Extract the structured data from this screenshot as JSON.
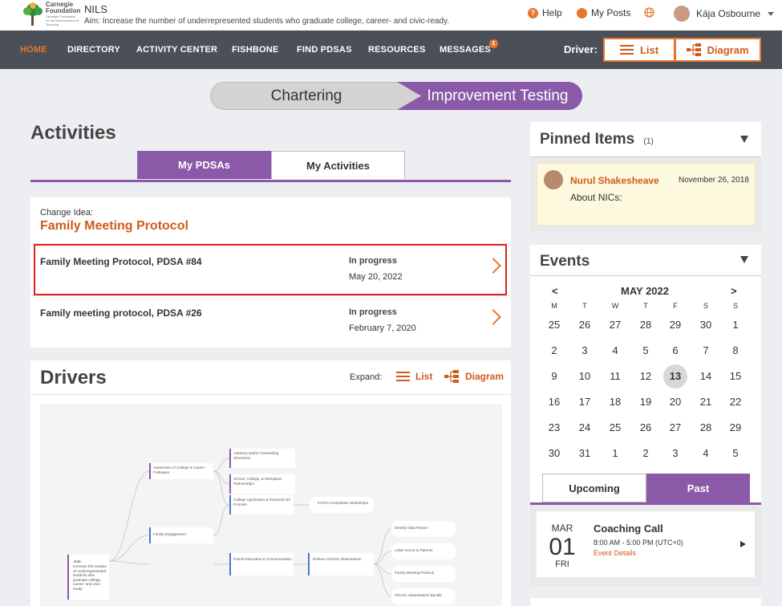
{
  "header": {
    "logo_text": "Carnegie Foundation for the Advancement of Teaching",
    "logo_line1": "Carnegie",
    "logo_line2": "Foundation",
    "site_name": "NILS",
    "aim": "Aim:  Increase the number of underrepresented students who graduate college, career- and civic-ready.",
    "help": "Help",
    "my_posts": "My Posts",
    "user_name": "Kája Osbourne"
  },
  "nav": {
    "items": [
      "HOME",
      "DIRECTORY",
      "ACTIVITY CENTER",
      "FISHBONE",
      "FIND PDSAS",
      "RESOURCES",
      "MESSAGES"
    ],
    "messages_badge": "1",
    "driver_label": "Driver:",
    "list_btn": "List",
    "diagram_btn": "Diagram"
  },
  "stages": {
    "left": "Chartering",
    "right": "Improvement Testing"
  },
  "activities": {
    "title": "Activities",
    "tabs": [
      "My PDSAs",
      "My Activities"
    ],
    "change_idea_label": "Change Idea:",
    "change_idea_title": "Family Meeting Protocol",
    "pdsas": [
      {
        "name": "Family Meeting Protocol, PDSA #84",
        "status": "In progress",
        "date": "May 20, 2022"
      },
      {
        "name": "Family meeting protocol, PDSA #26",
        "status": "In progress",
        "date": "February 7, 2020"
      }
    ]
  },
  "drivers": {
    "title": "Drivers",
    "expand_label": "Expand:",
    "list_link": "List",
    "diagram_link": "Diagram",
    "diagram_nodes": {
      "aim_title": "Aim",
      "aim_text": "Increase the number of underrepresented students who graduate college, career- and civic-ready.",
      "primary": [
        "Awareness of College & Career Pathways",
        "Family Engagement",
        "Parent Education & Communication"
      ],
      "secondary": [
        "Advisory and/or Counseling Structures",
        "School, College, & Workplace Partnerships",
        "College Application & Financial Aid Process",
        "Reduce Chronic Absenteeism"
      ],
      "change_ideas": [
        "FAFSA Completion Workshops",
        "Weekly Data Report",
        "Letter Home to Parents",
        "Family Meeting Protocol",
        "Chronic Absenteeism Bundle"
      ]
    }
  },
  "pinned": {
    "title": "Pinned Items",
    "count": "(1)",
    "item": {
      "author": "Nurul Shakesheave",
      "date": "November 26, 2018",
      "text": "About NICs:"
    }
  },
  "events": {
    "title": "Events",
    "month": "MAY 2022",
    "prev": "<",
    "next": ">",
    "dow": [
      "M",
      "T",
      "W",
      "T",
      "F",
      "S",
      "S"
    ],
    "weeks": [
      [
        "25",
        "26",
        "27",
        "28",
        "29",
        "30",
        "1"
      ],
      [
        "2",
        "3",
        "4",
        "5",
        "6",
        "7",
        "8"
      ],
      [
        "9",
        "10",
        "11",
        "12",
        "13",
        "14",
        "15"
      ],
      [
        "16",
        "17",
        "18",
        "19",
        "20",
        "21",
        "22"
      ],
      [
        "23",
        "24",
        "25",
        "26",
        "27",
        "28",
        "29"
      ],
      [
        "30",
        "31",
        "1",
        "2",
        "3",
        "4",
        "5"
      ]
    ],
    "today": "13",
    "tabs": [
      "Upcoming",
      "Past"
    ],
    "event": {
      "month": "MAR",
      "day": "01",
      "weekday": "FRI",
      "title": "Coaching Call",
      "time": "8:00 AM - 5:00 PM (UTC+0)",
      "details": "Event Details"
    }
  },
  "colors": {
    "accent": "#e8762d",
    "purple": "#8a5aa8",
    "nav_bg": "#4b4f58",
    "highlight": "#e02020"
  }
}
